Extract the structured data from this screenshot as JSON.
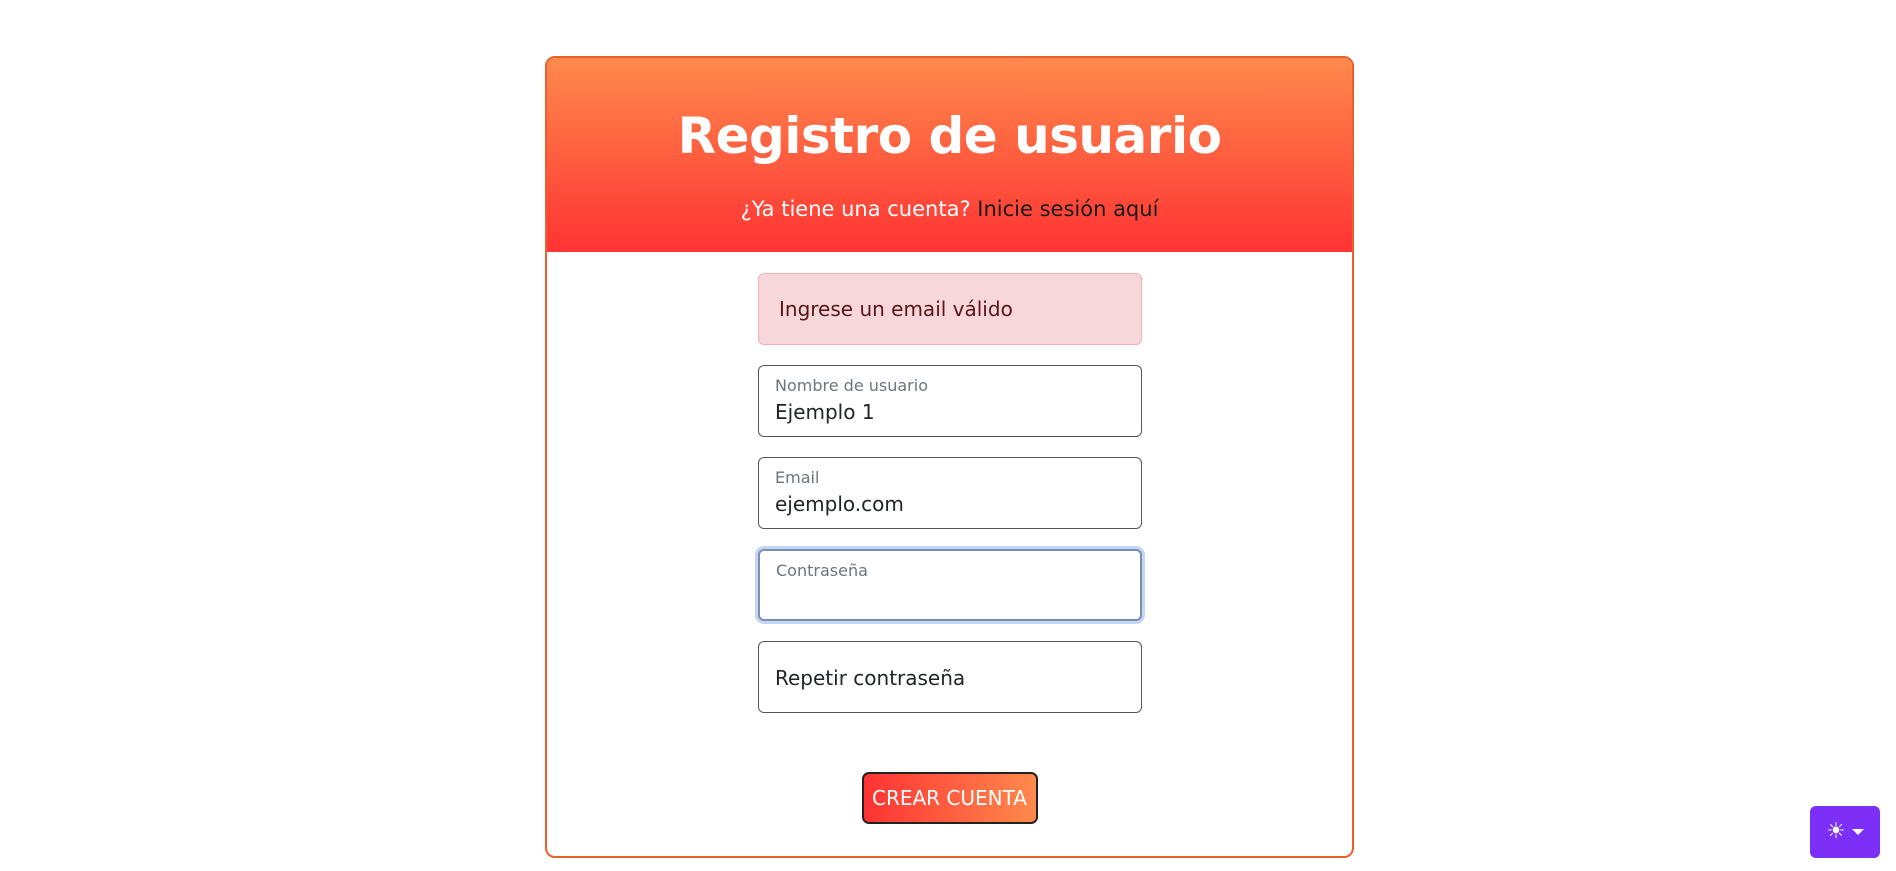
{
  "header": {
    "title": "Registro de usuario",
    "subtitle_prefix": "¿Ya tiene una cuenta?",
    "login_link": "Inicie sesión aquí"
  },
  "alert": {
    "message": "Ingrese un email válido"
  },
  "form": {
    "username": {
      "label": "Nombre de usuario",
      "value": "Ejemplo 1"
    },
    "email": {
      "label": "Email",
      "value": "ejemplo.com"
    },
    "password": {
      "label": "Contraseña",
      "value": ""
    },
    "repeat_password": {
      "placeholder": "Repetir contraseña"
    },
    "submit_label": "CREAR CUENTA"
  },
  "theme_toggle": {
    "icon": "sun-icon",
    "glyph": "☀"
  },
  "colors": {
    "header_top": "#ff8a4c",
    "header_bottom": "#ff3333",
    "card_border": "#e8612c",
    "alert_bg": "#f8d7da",
    "theme_button": "#7b2ff7"
  }
}
